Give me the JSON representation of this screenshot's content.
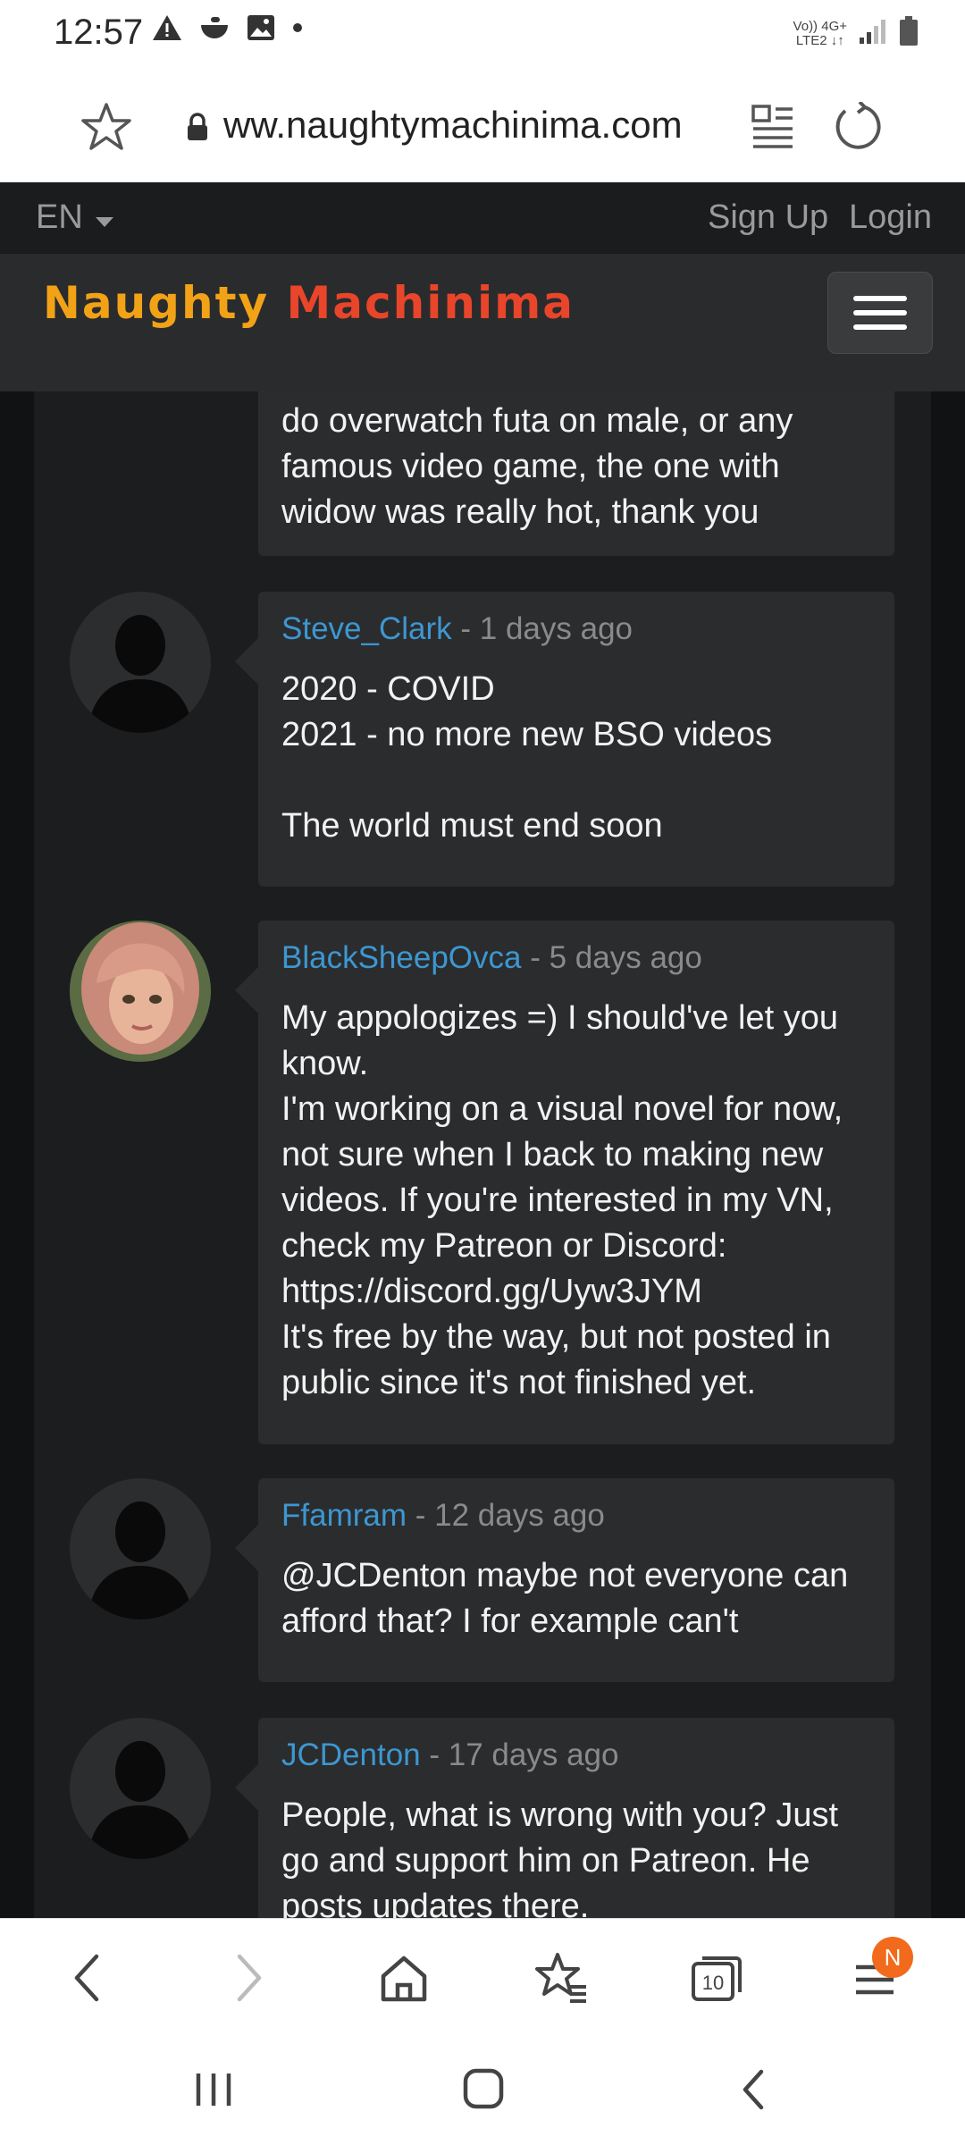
{
  "status_bar": {
    "time": "12:57",
    "network_top": "Vo)) 4G+",
    "network_bottom": "LTE2 ↓↑"
  },
  "browser": {
    "url": "ww.naughtymachinima.com"
  },
  "site": {
    "language": "EN",
    "signup_label": "Sign Up",
    "login_label": "Login",
    "logo_part1": "Naughty",
    "logo_part2": "Machinima",
    "brand_color_1": "#f2a217",
    "brand_color_2": "#e8452a",
    "link_color": "#3d97d1"
  },
  "comments": [
    {
      "username": "",
      "time": "",
      "text": "do overwatch futa on male, or any\nfamous video game, the one with\nwidow was really hot, thank you"
    },
    {
      "username": "Steve_Clark",
      "time": "- 1 days ago",
      "text": "2020 - COVID\n2021 - no more new BSO videos\n\nThe world must end soon"
    },
    {
      "username": "BlackSheepOvca",
      "time": "- 5 days ago",
      "text": "My appologizes =) I should've let you\nknow.\nI'm working on a visual novel for now,\nnot sure when I back to making new\nvideos. If you're interested in my VN,\ncheck my Patreon or Discord:\nhttps://discord.gg/Uyw3JYM\nIt's free by the way, but not posted in\npublic since it's not finished yet."
    },
    {
      "username": "Ffamram",
      "time": "- 12 days ago",
      "text": "@JCDenton maybe not everyone can\nafford that? I for example can't"
    },
    {
      "username": "JCDenton",
      "time": "- 17 days ago",
      "text": "People, what is wrong with you? Just\ngo and support him on Patreon. He\nposts updates there."
    }
  ],
  "bottom_nav": {
    "tabs_count": "10",
    "badge": "N"
  }
}
